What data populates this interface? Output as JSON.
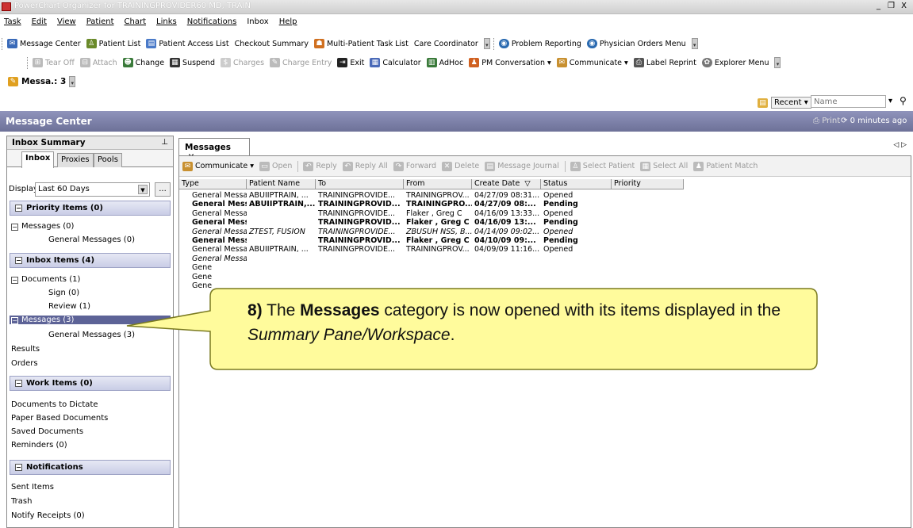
{
  "window": {
    "title": "PowerChart Organizer for TRAININGPROVIDER60 MD, TRAIN",
    "controls": [
      "_",
      "❐",
      "X"
    ]
  },
  "menu": [
    "Task",
    "Edit",
    "View",
    "Patient",
    "Chart",
    "Links",
    "Notifications",
    "Inbox",
    "Help"
  ],
  "toolbar1": [
    {
      "label": "Message Center",
      "icon": "message-center-icon"
    },
    {
      "label": "Patient List",
      "icon": "patient-list-icon"
    },
    {
      "label": "Patient Access List",
      "icon": "patient-access-list-icon"
    },
    {
      "label": "Checkout Summary",
      "icon": ""
    },
    {
      "label": "Multi-Patient Task List",
      "icon": "multi-patient-icon"
    },
    {
      "label": "Care Coordinator",
      "icon": ""
    },
    {
      "label": "Problem Reporting",
      "icon": "problem-reporting-icon"
    },
    {
      "label": "Physician Orders Menu",
      "icon": "physician-orders-icon"
    }
  ],
  "toolbar2": [
    {
      "label": "Tear Off",
      "icon": "tear-off-icon",
      "disabled": true
    },
    {
      "label": "Attach",
      "icon": "attach-icon",
      "disabled": true
    },
    {
      "label": "Change",
      "icon": "change-icon",
      "disabled": false
    },
    {
      "label": "Suspend",
      "icon": "suspend-icon",
      "disabled": false
    },
    {
      "label": "Charges",
      "icon": "charges-icon",
      "disabled": true
    },
    {
      "label": "Charge Entry",
      "icon": "charge-entry-icon",
      "disabled": true
    },
    {
      "label": "Exit",
      "icon": "exit-icon",
      "disabled": false
    },
    {
      "label": "Calculator",
      "icon": "calculator-icon",
      "disabled": false
    },
    {
      "label": "AdHoc",
      "icon": "adhoc-icon",
      "disabled": false
    },
    {
      "label": "PM Conversation ▾",
      "icon": "pm-conversation-icon",
      "disabled": false
    },
    {
      "label": "Communicate ▾",
      "icon": "communicate-icon",
      "disabled": false
    },
    {
      "label": "Label Reprint",
      "icon": "label-reprint-icon",
      "disabled": false
    },
    {
      "label": "Explorer Menu",
      "icon": "explorer-menu-icon",
      "disabled": false
    }
  ],
  "messa_tab": "Messa.: 3",
  "recent": {
    "label": "Recent ▾",
    "name_placeholder": "Name"
  },
  "header": {
    "title": "Message Center",
    "print": "Print",
    "refresh": "0 minutes ago"
  },
  "left": {
    "title": "Inbox Summary",
    "tabs": [
      "Inbox",
      "Proxies",
      "Pools"
    ],
    "display_label": "Display",
    "display_value": "Last 60 Days",
    "dots": "...",
    "priority": {
      "title": "Priority Items (0)",
      "items": [
        "Messages (0)",
        "General Messages (0)"
      ]
    },
    "inbox": {
      "title": "Inbox Items (4)",
      "items": [
        "Documents (1)",
        "Sign (0)",
        "Review (1)",
        "Messages (3)",
        "General Messages (3)",
        "Results",
        "Orders"
      ]
    },
    "work": {
      "title": "Work Items (0)",
      "items": [
        "Documents to Dictate",
        "Paper Based Documents",
        "Saved Documents",
        "Reminders (0)"
      ]
    },
    "notifications": {
      "title": "Notifications",
      "items": [
        "Sent Items",
        "Trash",
        "Notify Receipts (0)"
      ]
    }
  },
  "doc_tab": "Messages",
  "rtoolbar": [
    {
      "label": "Communicate ▾",
      "disabled": false
    },
    {
      "label": "Open",
      "disabled": true
    },
    {
      "label": "Reply",
      "disabled": true
    },
    {
      "label": "Reply All",
      "disabled": true
    },
    {
      "label": "Forward",
      "disabled": true
    },
    {
      "label": "Delete",
      "disabled": true
    },
    {
      "label": "Message Journal",
      "disabled": true
    },
    {
      "label": "Select Patient",
      "disabled": true
    },
    {
      "label": "Select All",
      "disabled": true
    },
    {
      "label": "Patient Match",
      "disabled": true
    }
  ],
  "columns": [
    "Type",
    "Patient Name",
    "To",
    "From",
    "Create Date",
    "Status",
    "Priority"
  ],
  "rows": [
    {
      "type": "General Messages",
      "patient": "ABUIIPTRAIN, ...",
      "to": "TRAININGPROVIDE...",
      "from": "TRAININGPROV...",
      "date": "04/27/09 08:31...",
      "status": "Opened",
      "style": ""
    },
    {
      "type": "General Messag...",
      "patient": "ABUIIPTRAIN,...",
      "to": "TRAININGPROVID...",
      "from": "TRAININGPRO...",
      "date": "04/27/09 08:...",
      "status": "Pending",
      "style": "bold"
    },
    {
      "type": "General Messages",
      "patient": "",
      "to": "TRAININGPROVIDE...",
      "from": "Flaker , Greg C",
      "date": "04/16/09 13:33...",
      "status": "Opened",
      "style": ""
    },
    {
      "type": "General Messag...",
      "patient": "",
      "to": "TRAININGPROVID...",
      "from": "Flaker , Greg C",
      "date": "04/16/09 13:...",
      "status": "Pending",
      "style": "bold"
    },
    {
      "type": "General Messages",
      "patient": "ZTEST, FUSION",
      "to": "TRAININGPROVIDE...",
      "from": "ZBUSUH NSS, B...",
      "date": "04/14/09 09:02...",
      "status": "Opened",
      "style": "italic"
    },
    {
      "type": "General Messag...",
      "patient": "",
      "to": "TRAININGPROVID...",
      "from": "Flaker , Greg C",
      "date": "04/10/09 09:...",
      "status": "Pending",
      "style": "bold"
    },
    {
      "type": "General Messages",
      "patient": "ABUIIPTRAIN, ...",
      "to": "TRAININGPROVIDE...",
      "from": "TRAININGPROV...",
      "date": "04/09/09 11:16...",
      "status": "Opened",
      "style": ""
    },
    {
      "type": "General Messages",
      "patient": "",
      "to": "",
      "from": "",
      "date": "",
      "status": "",
      "style": "italic"
    },
    {
      "type": "Gene",
      "patient": "",
      "to": "",
      "from": "",
      "date": "",
      "status": "",
      "style": ""
    },
    {
      "type": "Gene",
      "patient": "",
      "to": "",
      "from": "",
      "date": "",
      "status": "",
      "style": ""
    },
    {
      "type": "Gene",
      "patient": "",
      "to": "",
      "from": "",
      "date": "",
      "status": "",
      "style": ""
    }
  ],
  "callout": {
    "number": "8)",
    "pre": " The ",
    "bold": "Messages",
    "mid": " category is now opened with its items displayed in the ",
    "italic": "Summary Pane/Workspace",
    "post": "."
  },
  "colors": {
    "header": "#6d7198",
    "selected": "#5d6397",
    "callout_fill": "#fffb9c",
    "callout_border": "#7a7a20"
  }
}
